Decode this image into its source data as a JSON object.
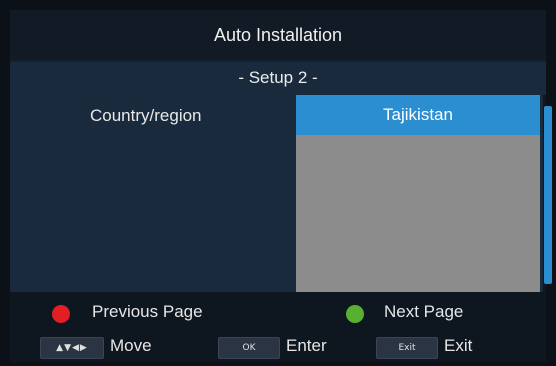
{
  "header": {
    "title": "Auto Installation"
  },
  "main": {
    "subtitle": "- Setup 2 -",
    "country_label": "Country/region",
    "country_list": {
      "selected": "Tajikistan"
    }
  },
  "footer": {
    "previous_page": "Previous Page",
    "next_page": "Next Page",
    "arrows_key": "▲▼◀▶",
    "move": "Move",
    "ok_key": "OK",
    "enter": "Enter",
    "exit_key": "Exit",
    "exit": "Exit"
  },
  "colors": {
    "accent": "#2a8ed1",
    "red_button": "#e31e24",
    "green_button": "#58b030"
  }
}
